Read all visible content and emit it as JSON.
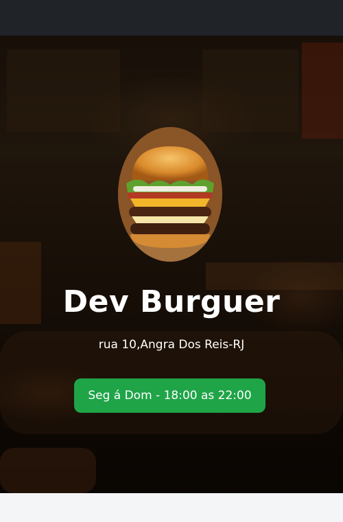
{
  "restaurant": {
    "name": "Dev Burguer",
    "address": "rua 10,Angra Dos Reis-RJ",
    "hours": "Seg á Dom - 18:00 as 22:00"
  },
  "colors": {
    "topbar": "#202327",
    "hours_badge": "#1fa448",
    "text": "#ffffff",
    "page_bg": "#f4f5f7"
  },
  "icons": {
    "logo": "burger-logo-image"
  }
}
